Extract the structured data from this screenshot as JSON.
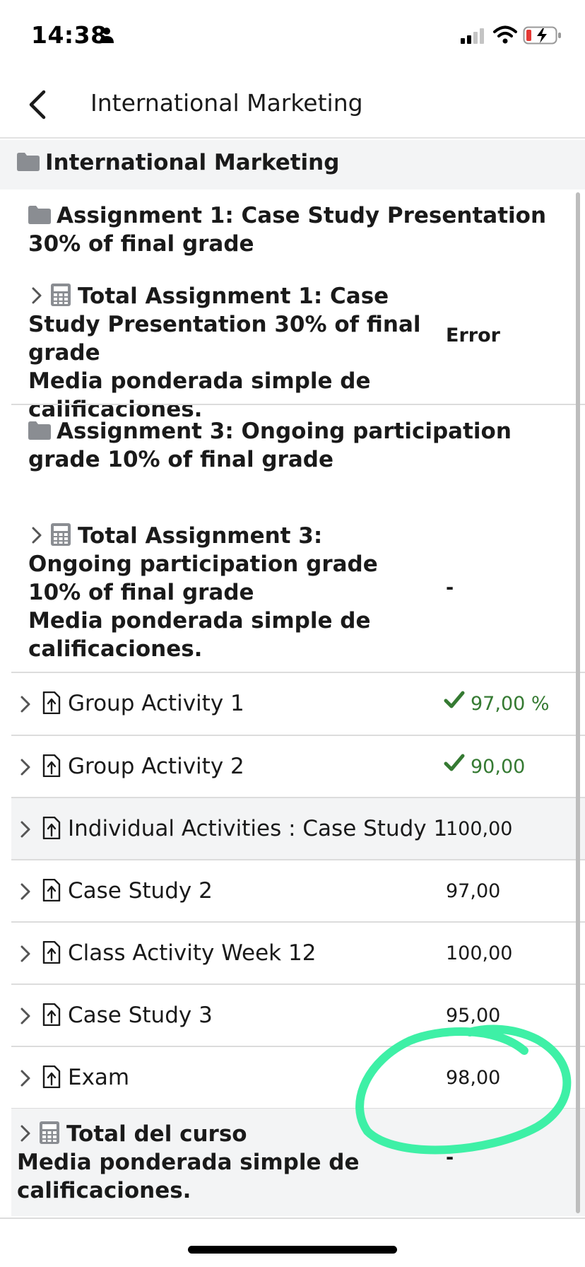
{
  "status_bar": {
    "time": "14:38",
    "icons": [
      "person-icon",
      "signal-icon",
      "wifi-icon",
      "battery-charging-icon"
    ]
  },
  "nav": {
    "title": "International Marketing",
    "back_icon": "chevron-left-icon"
  },
  "course": {
    "name": "International Marketing"
  },
  "categories": [
    {
      "name": "Assignment 1: Case Study Presentation 30% of final grade",
      "total": {
        "label": "Total Assignment 1: Case Study Presentation 30% of final grade",
        "method": "Media ponderada simple de calificaciones.",
        "value": "Error"
      }
    },
    {
      "name": "Assignment 3: Ongoing participation grade 10% of final grade",
      "total": {
        "label": "Total Assignment 3: Ongoing participation grade 10% of final grade",
        "method": "Media ponderada simple de calificaciones.",
        "value": "-"
      }
    }
  ],
  "items": [
    {
      "label": "Group Activity 1",
      "value": "97,00 %",
      "passed": true
    },
    {
      "label": "Group Activity 2",
      "value": "90,00",
      "passed": true
    },
    {
      "label": "Individual Activities : Case Study 1",
      "value": "100,00",
      "passed": false
    },
    {
      "label": "Case Study 2",
      "value": "97,00",
      "passed": false
    },
    {
      "label": "Class Activity Week 12",
      "value": "100,00",
      "passed": false
    },
    {
      "label": "Case Study 3",
      "value": "95,00",
      "passed": false
    },
    {
      "label": "Exam",
      "value": "98,00",
      "passed": false
    }
  ],
  "course_total": {
    "label": "Total del curso",
    "method": "Media ponderada simple de calificaciones.",
    "value": "-"
  },
  "colors": {
    "pass": "#357a32",
    "annotation": "#3ef0a6",
    "shaded_row": "#f3f4f5",
    "icon_gray": "#8a8d92"
  }
}
